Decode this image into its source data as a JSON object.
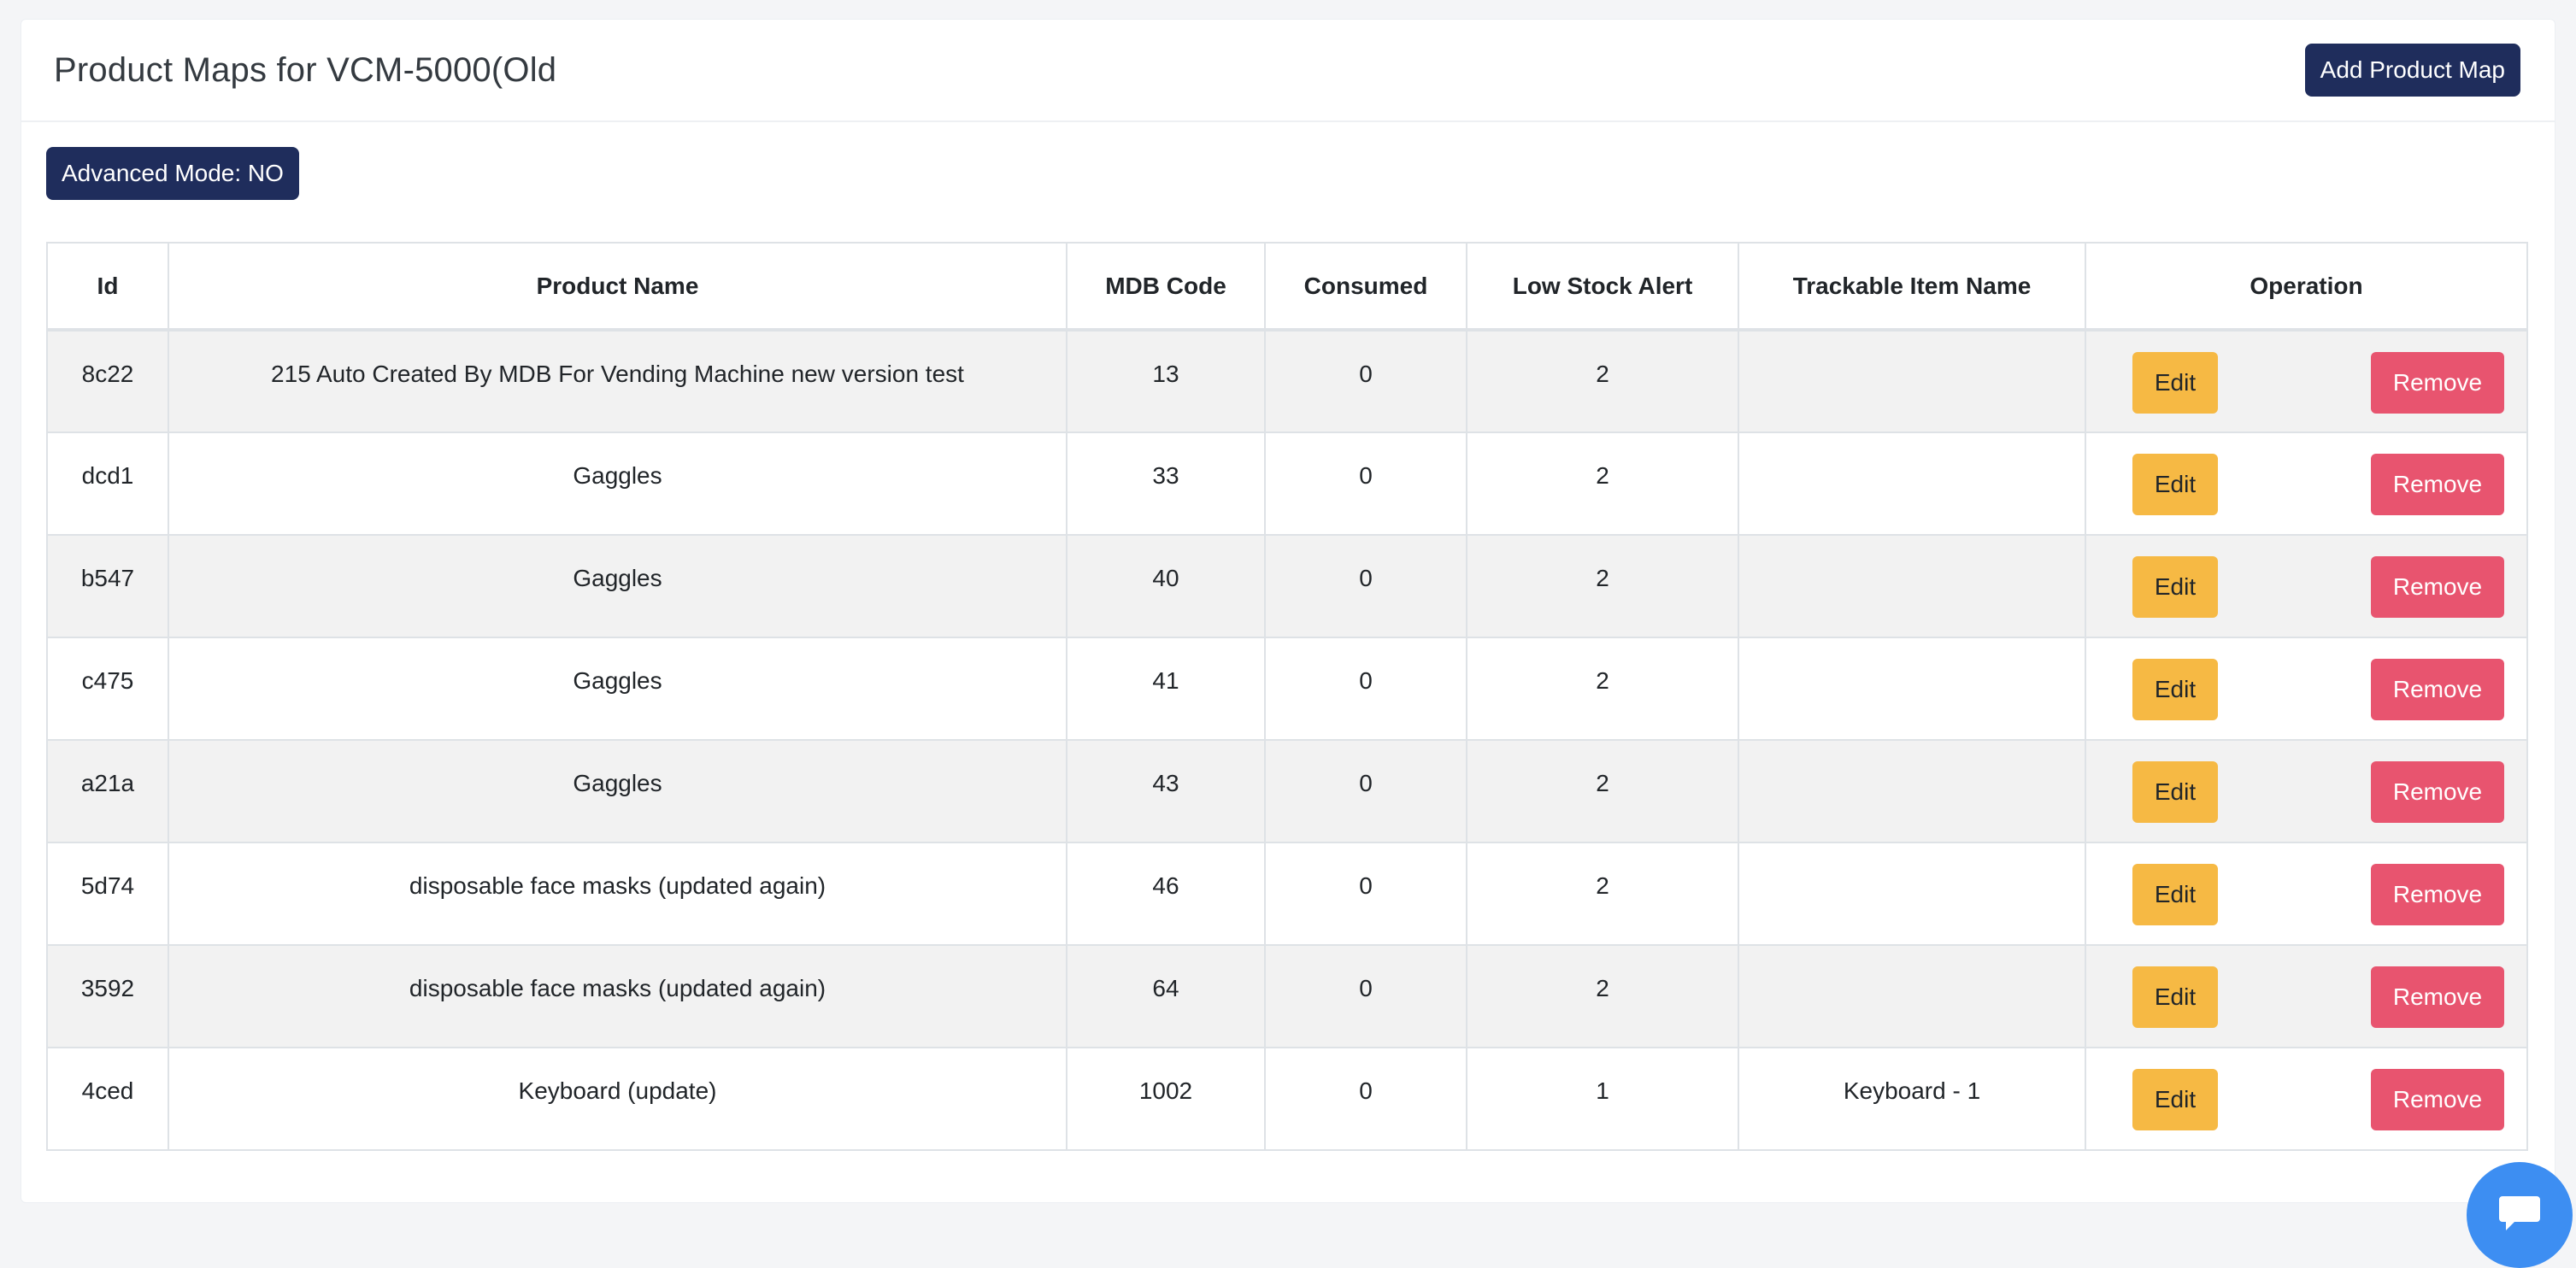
{
  "header": {
    "title": "Product Maps for VCM-5000(Old",
    "add_button": "Add Product Map"
  },
  "advanced_mode_button": "Advanced Mode: NO",
  "table": {
    "columns": [
      "Id",
      "Product Name",
      "MDB Code",
      "Consumed",
      "Low Stock Alert",
      "Trackable Item Name",
      "Operation"
    ],
    "rows": [
      {
        "id": "8c22",
        "product_name": "215 Auto Created By MDB For Vending Machine new version test",
        "mdb_code": "13",
        "consumed": "0",
        "low_stock_alert": "2",
        "trackable_item_name": ""
      },
      {
        "id": "dcd1",
        "product_name": "Gaggles",
        "mdb_code": "33",
        "consumed": "0",
        "low_stock_alert": "2",
        "trackable_item_name": ""
      },
      {
        "id": "b547",
        "product_name": "Gaggles",
        "mdb_code": "40",
        "consumed": "0",
        "low_stock_alert": "2",
        "trackable_item_name": ""
      },
      {
        "id": "c475",
        "product_name": "Gaggles",
        "mdb_code": "41",
        "consumed": "0",
        "low_stock_alert": "2",
        "trackable_item_name": ""
      },
      {
        "id": "a21a",
        "product_name": "Gaggles",
        "mdb_code": "43",
        "consumed": "0",
        "low_stock_alert": "2",
        "trackable_item_name": ""
      },
      {
        "id": "5d74",
        "product_name": "disposable face masks (updated again)",
        "mdb_code": "46",
        "consumed": "0",
        "low_stock_alert": "2",
        "trackable_item_name": ""
      },
      {
        "id": "3592",
        "product_name": "disposable face masks (updated again)",
        "mdb_code": "64",
        "consumed": "0",
        "low_stock_alert": "2",
        "trackable_item_name": ""
      },
      {
        "id": "4ced",
        "product_name": "Keyboard (update)",
        "mdb_code": "1002",
        "consumed": "0",
        "low_stock_alert": "1",
        "trackable_item_name": "Keyboard - 1"
      }
    ],
    "edit_label": "Edit",
    "remove_label": "Remove"
  },
  "icons": {
    "chat": "chat-bubble-icon"
  },
  "colors": {
    "primary_navy": "#1f2d5c",
    "edit_yellow": "#f6b944",
    "remove_red": "#e8546f",
    "chat_blue": "#3d8ef2",
    "striped_row": "#f2f2f2"
  }
}
